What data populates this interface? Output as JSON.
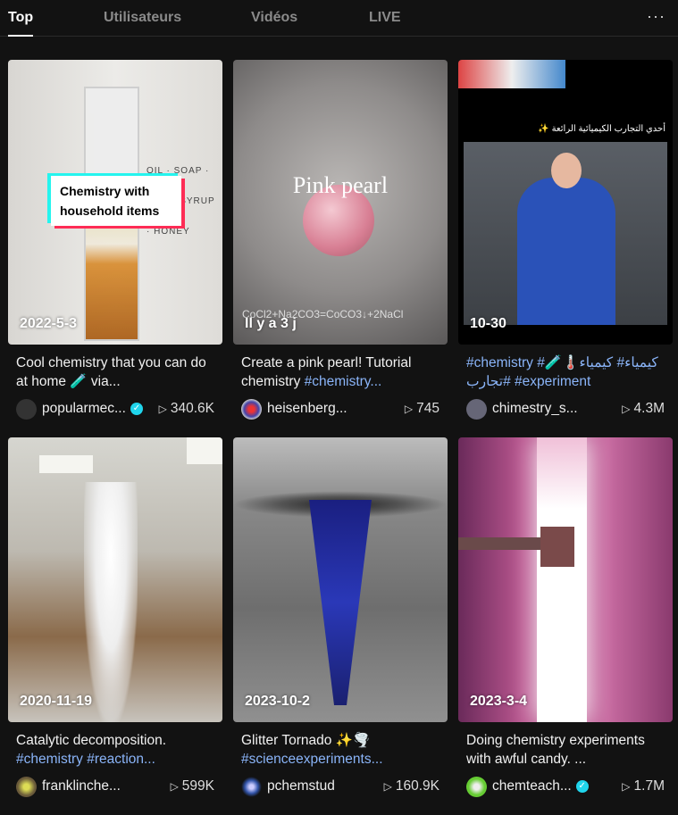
{
  "tabs": [
    {
      "label": "Top",
      "active": true
    },
    {
      "label": "Utilisateurs"
    },
    {
      "label": "Vidéos"
    },
    {
      "label": "LIVE"
    }
  ],
  "more_icon": "ellipsis-icon",
  "accent_tag_color": "#8ab4f8",
  "videos": [
    {
      "date": "2022-5-3",
      "overlay": "Chemistry with household items",
      "overlay2": "OIL · SOAP · CORN SYRUP · HONEY",
      "desc": "Cool chemistry that you can do at home 🧪 via...",
      "tags": "",
      "user": "popularmec...",
      "verified": true,
      "views": "340.6K"
    },
    {
      "date": "Il y a 3 j",
      "overlay": "Pink pearl",
      "overlay2": "CoCl2+Na2CO3=CoCO3↓+2NaCl",
      "desc": "Create a pink pearl! Tutorial chemistry ",
      "tags": "#chemistry...",
      "user": "heisenberg...",
      "verified": false,
      "views": "745"
    },
    {
      "date": "10-30",
      "overlay": "أحدي التجارب الكيميائية الرائعة ✨",
      "overlay2": "",
      "desc": "",
      "tags": "#chemistry #كيمياء# كيمياء🌡️🧪 #تجارب #experiment",
      "user": "chimestry_s...",
      "verified": false,
      "views": "4.3M"
    },
    {
      "date": "2020-11-19",
      "overlay": "",
      "overlay2": "",
      "desc": "Catalytic decomposition. ",
      "tags": "#chemistry #reaction...",
      "user": "franklinche...",
      "verified": false,
      "views": "599K"
    },
    {
      "date": "2023-10-2",
      "overlay": "",
      "overlay2": "",
      "desc": "Glitter Tornado ✨🌪️ ",
      "tags": "#scienceexperiments...",
      "user": "pchemstud",
      "verified": false,
      "views": "160.9K"
    },
    {
      "date": "2023-3-4",
      "overlay": "",
      "overlay2": "",
      "desc": "Doing chemistry experiments with awful candy. ...",
      "tags": "",
      "user": "chemteach...",
      "verified": true,
      "views": "1.7M"
    }
  ]
}
